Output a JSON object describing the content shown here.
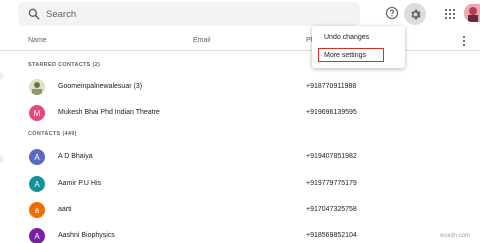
{
  "search": {
    "placeholder": "Search"
  },
  "icons": {
    "search": "search-icon",
    "help": "help-icon",
    "settings": "gear-icon",
    "apps": "apps-grid-icon",
    "more": "more-vert-icon"
  },
  "table_header": {
    "name": "Name",
    "email": "Email",
    "phone": "Ph"
  },
  "starred": {
    "heading": "STARRED CONTACTS (2)",
    "contacts": [
      {
        "initial": "",
        "name": "Goomeinpalnewalesuar (3)",
        "phone": "+918770911988",
        "avatar_color": "#c8d6a8"
      },
      {
        "initial": "M",
        "name": "Mukesh Bhai Phd Indian Theatre",
        "phone": "+919696139595",
        "avatar_color": "#e8487f"
      }
    ]
  },
  "contacts": {
    "heading": "CONTACTS (449)",
    "list": [
      {
        "initial": "A",
        "name": "A D Bhaiya",
        "phone": "+919407851982",
        "avatar_color": "#5c6bc0"
      },
      {
        "initial": "A",
        "name": "Aamir P.U His",
        "phone": "+919779775179",
        "avatar_color": "#12939a"
      },
      {
        "initial": "a",
        "name": "aarti",
        "phone": "+917047325758",
        "avatar_color": "#ef6c00"
      },
      {
        "initial": "A",
        "name": "Aashni Biophysics",
        "phone": "+918569852104",
        "avatar_color": "#7b1fa2"
      }
    ]
  },
  "settings_menu": {
    "items": [
      "Undo changes",
      "More settings"
    ],
    "highlight_color": "#d93025"
  },
  "watermark": "wsxdn.com"
}
